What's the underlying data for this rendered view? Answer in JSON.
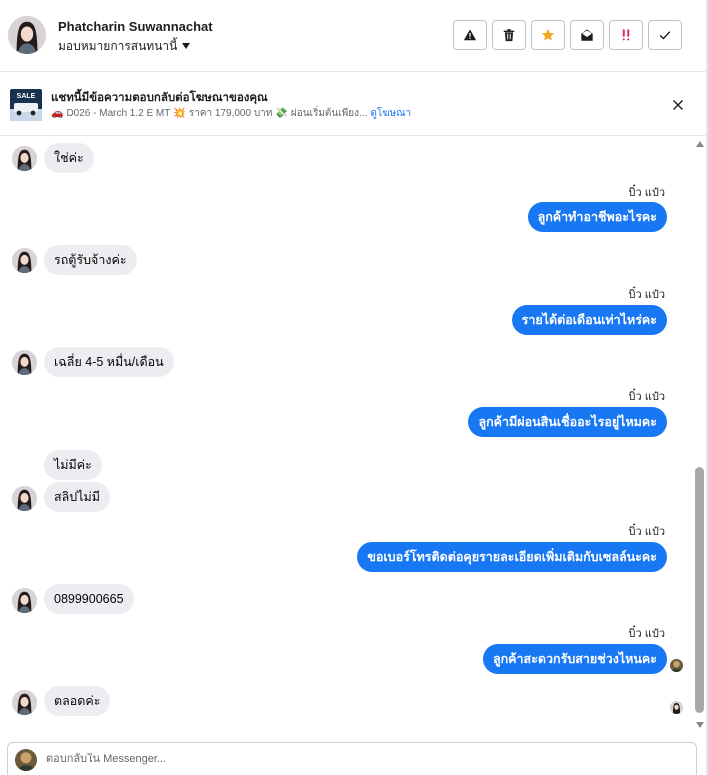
{
  "header": {
    "name": "Phatcharin Suwannachat",
    "assign_label": "มอบหมายการสนทนานี้",
    "actions": [
      "spam-icon",
      "trash-icon",
      "star-icon",
      "mark-unread-icon",
      "follow-up-icon",
      "done-icon"
    ],
    "star_color": "#f5a623",
    "follow_up_color": "#e0245e"
  },
  "ad_banner": {
    "title": "แชทนี้มีข้อความตอบกลับต่อโฆษณาของคุณ",
    "desc_part1": "D026 - March 1.2 E MT",
    "desc_part2": "ราคา 179,000 บาท",
    "desc_part3": "ผ่อนเริ่มต้นเพียง...",
    "link": "ดูโฆษณา",
    "thumb_text": "SALE"
  },
  "thread": {
    "messages": [
      {
        "from": "customer",
        "text": "ใช่ค่ะ"
      },
      {
        "from": "page",
        "sender": "บิ๋ว แป๋ว",
        "text": "ลูกค้าทำอาชีพอะไรคะ"
      },
      {
        "from": "customer",
        "text": "รถตู้รับจ้างค่ะ"
      },
      {
        "from": "page",
        "sender": "บิ๋ว แป๋ว",
        "text": "รายได้ต่อเดือนเท่าไหร่คะ"
      },
      {
        "from": "customer",
        "text": "เฉลี่ย 4-5 หมื่น/เดือน"
      },
      {
        "from": "page",
        "sender": "บิ๋ว แป๋ว",
        "text": "ลูกค้ามีผ่อนสินเชื่ออะไรอยู่ไหมคะ"
      },
      {
        "from": "customer",
        "text": "ไม่มีค่ะ"
      },
      {
        "from": "customer",
        "text": "สลิปไม่มี"
      },
      {
        "from": "page",
        "sender": "บิ๋ว แป๋ว",
        "text": "ขอเบอร์โทรติดต่อคุยรายละเอียดเพิ่มเติมกับเซลล์นะคะ"
      },
      {
        "from": "customer",
        "text": "0899900665"
      },
      {
        "from": "page",
        "sender": "บิ๋ว แป๋ว",
        "text": "ลูกค้าสะดวกรับสายช่วงไหนคะ"
      },
      {
        "from": "customer",
        "text": "ตลอดค่ะ"
      }
    ],
    "bubble_in_color": "#ebedf0",
    "bubble_out_color": "#1877f2"
  },
  "composer": {
    "placeholder": "ตอบกลับใน Messenger..."
  }
}
